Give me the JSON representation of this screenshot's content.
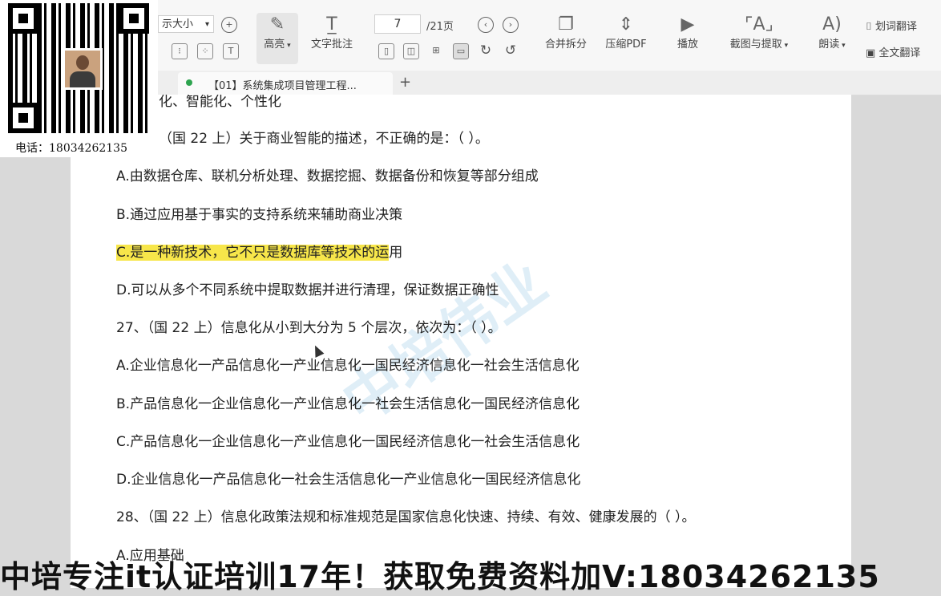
{
  "overlay": {
    "phone_label": "电话：18034262135"
  },
  "toolbar": {
    "font_size_label": "示大小",
    "highlight_label": "高亮",
    "text_comment_label": "文字批注",
    "page_current": "7",
    "page_total": "/21页",
    "merge_split_label": "合并拆分",
    "compress_label": "压缩PDF",
    "play_label": "播放",
    "screenshot_extract_label": "截图与提取",
    "read_aloud_label": "朗读",
    "word_translate_label": "划词翻译",
    "full_translate_label": "全文翻译"
  },
  "tabs": [
    {
      "label": "【01】系统集成项目管理工程..."
    }
  ],
  "document": {
    "lines": [
      "化、智能化、个性化",
      "（国 22 上）关于商业智能的描述，不正确的是：（ ）。",
      "A.由数据仓库、联机分析处理、数据挖掘、数据备份和恢复等部分组成",
      "B.通过应用基于事实的支持系统来辅助商业决策",
      "C.是一种新技术，它不只是数据库等技术的运",
      "用",
      "D.可以从多个不同系统中提取数据并进行清理，保证数据正确性",
      "27、（国 22 上）信息化从小到大分为 5 个层次，依次为：（ ）。",
      "A.企业信息化一产品信息化一产业信息化一国民经济信息化一社会生活信息化",
      "B.产品信息化一企业信息化一产业信息化一社会生活信息化一国民经济信息化",
      "C.产品信息化一企业信息化一产业信息化一国民经济信息化一社会生活信息化",
      "D.企业信息化一产品信息化一社会生活信息化一产业信息化一国民经济信息化",
      "28、（国 22 上）信息化政策法规和标准规范是国家信息化快速、持续、有效、健康发展的（ ）。",
      "A.应用基础"
    ],
    "watermark": "中培伟业"
  },
  "banner": {
    "text": "中培专注it认证培训17年！获取免费资料加V:18034262135"
  }
}
